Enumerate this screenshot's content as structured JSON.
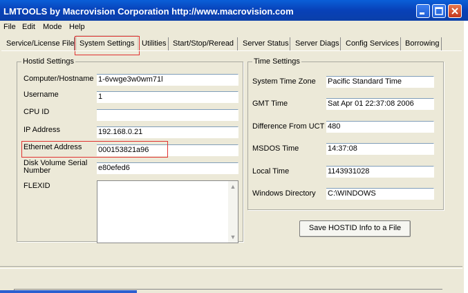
{
  "title": "LMTOOLS by Macrovision Corporation http://www.macrovision.com",
  "menu": [
    "File",
    "Edit",
    "Mode",
    "Help"
  ],
  "tabs": [
    "Service/License File",
    "System Settings",
    "Utilities",
    "Start/Stop/Reread",
    "Server Status",
    "Server Diags",
    "Config Services",
    "Borrowing"
  ],
  "active_tab": "System Settings",
  "hostid": {
    "legend": "Hostid Settings",
    "computer_label": "Computer/Hostname",
    "computer_value": "1-6vwge3w0wm71l",
    "username_label": "Username",
    "username_value": "1",
    "cpuid_label": "CPU ID",
    "cpuid_value": "",
    "ip_label": "IP Address",
    "ip_value": "192.168.0.21",
    "ethernet_label": "Ethernet Address",
    "ethernet_value": "000153821a96",
    "disk_label_1": "Disk Volume Serial",
    "disk_label_2": "Number",
    "disk_value": "e80efed6",
    "flexid_label": "FLEXID",
    "flexid_value": ""
  },
  "time": {
    "legend": "Time Settings",
    "tz_label": "System Time Zone",
    "tz_value": "Pacific Standard Time",
    "gmt_label": "GMT Time",
    "gmt_value": "Sat Apr 01 22:37:08 2006",
    "utc_label": "Difference From UCT",
    "utc_value": "480",
    "msdos_label": "MSDOS Time",
    "msdos_value": "14:37:08",
    "local_label": "Local Time",
    "local_value": "1143931028",
    "windir_label": "Windows Directory",
    "windir_value": "C:\\WINDOWS"
  },
  "save_button": "Save HOSTID Info to a File",
  "status_text": "",
  "colors": {
    "title_bar": "#0a4fc6",
    "client_bg": "#ece9d8",
    "highlight": "#e0302f"
  },
  "icons": {
    "minimize": "minimize-icon",
    "maximize": "maximize-icon",
    "close": "close-icon"
  }
}
